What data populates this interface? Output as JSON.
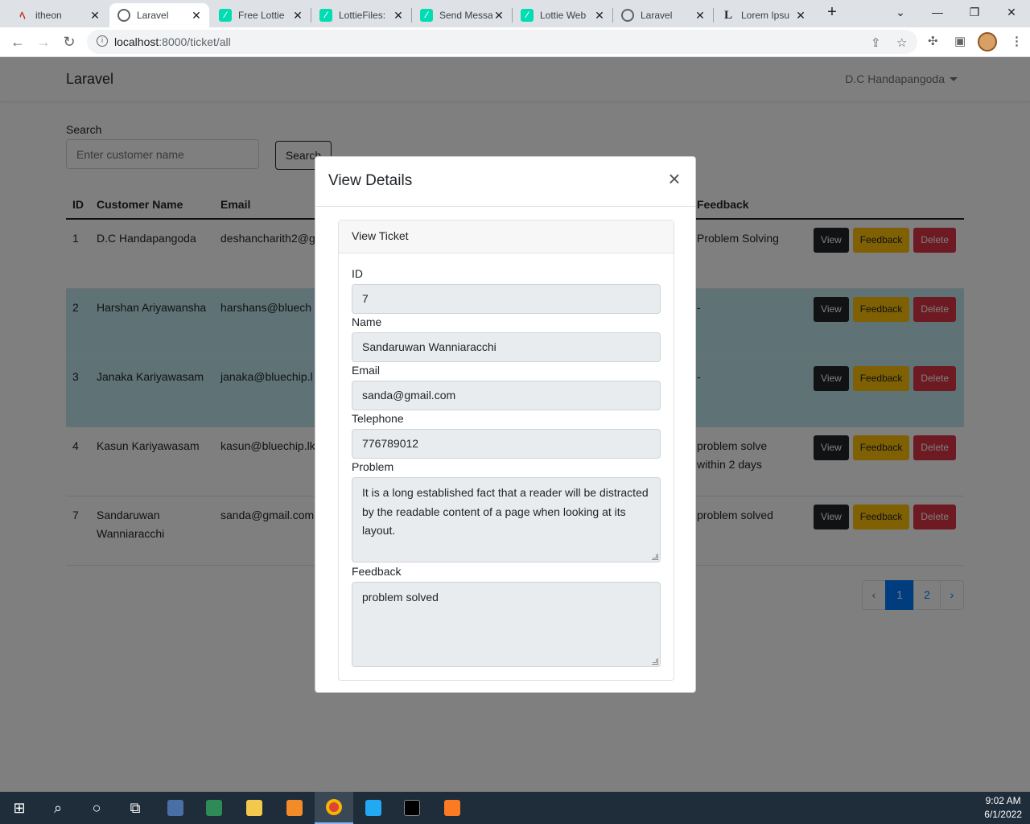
{
  "browser": {
    "tabs": [
      {
        "title": "itheon",
        "icon": "itheon-icon"
      },
      {
        "title": "Laravel",
        "icon": "globe-icon",
        "active": true
      },
      {
        "title": "Free Lottie",
        "icon": "lottie-icon"
      },
      {
        "title": "LottieFiles:",
        "icon": "lottie-icon"
      },
      {
        "title": "Send Messa",
        "icon": "lottie-icon"
      },
      {
        "title": "Lottie Web",
        "icon": "lottie-icon"
      },
      {
        "title": "Laravel",
        "icon": "globe-icon"
      },
      {
        "title": "Lorem Ipsu",
        "icon": "lorem-icon"
      }
    ],
    "url_host": "localhost",
    "url_rest": ":8000/ticket/all"
  },
  "navbar": {
    "brand": "Laravel",
    "user": "D.C Handapangoda"
  },
  "search": {
    "label": "Search",
    "placeholder": "Enter customer name",
    "button": "Search"
  },
  "table": {
    "headers": [
      "ID",
      "Customer Name",
      "Email",
      "Feedback"
    ],
    "rows": [
      {
        "id": "1",
        "name": "D.C Handapangoda",
        "email": "deshancharith2@g",
        "feedback": "Problem Solving"
      },
      {
        "id": "2",
        "name": "Harshan Ariyawansha",
        "email": "harshans@bluech",
        "feedback": "-"
      },
      {
        "id": "3",
        "name": "Janaka Kariyawasam",
        "email": "janaka@bluechip.l",
        "feedback": "-"
      },
      {
        "id": "4",
        "name": "Kasun Kariyawasam",
        "email": "kasun@bluechip.lk",
        "feedback": "problem solve within 2 days"
      },
      {
        "id": "7",
        "name": "Sandaruwan Wanniaracchi",
        "email": "sanda@gmail.com",
        "feedback": "problem solved"
      }
    ],
    "actions": {
      "view": "View",
      "feedback": "Feedback",
      "delete": "Delete"
    }
  },
  "pagination": {
    "prev": "‹",
    "pages": [
      "1",
      "2"
    ],
    "next": "›",
    "current": "1"
  },
  "modal": {
    "title": "View Details",
    "card_title": "View Ticket",
    "fields": {
      "id_label": "ID",
      "id_value": "7",
      "name_label": "Name",
      "name_value": "Sandaruwan Wanniaracchi",
      "email_label": "Email",
      "email_value": "sanda@gmail.com",
      "phone_label": "Telephone",
      "phone_value": "776789012",
      "problem_label": "Problem",
      "problem_value": "It is a long established fact that a reader will be distracted by the readable content of a page when looking at its layout.",
      "feedback_label": "Feedback",
      "feedback_value": "problem solved"
    }
  },
  "taskbar": {
    "time": "9:02 AM",
    "date": "6/1/2022"
  }
}
